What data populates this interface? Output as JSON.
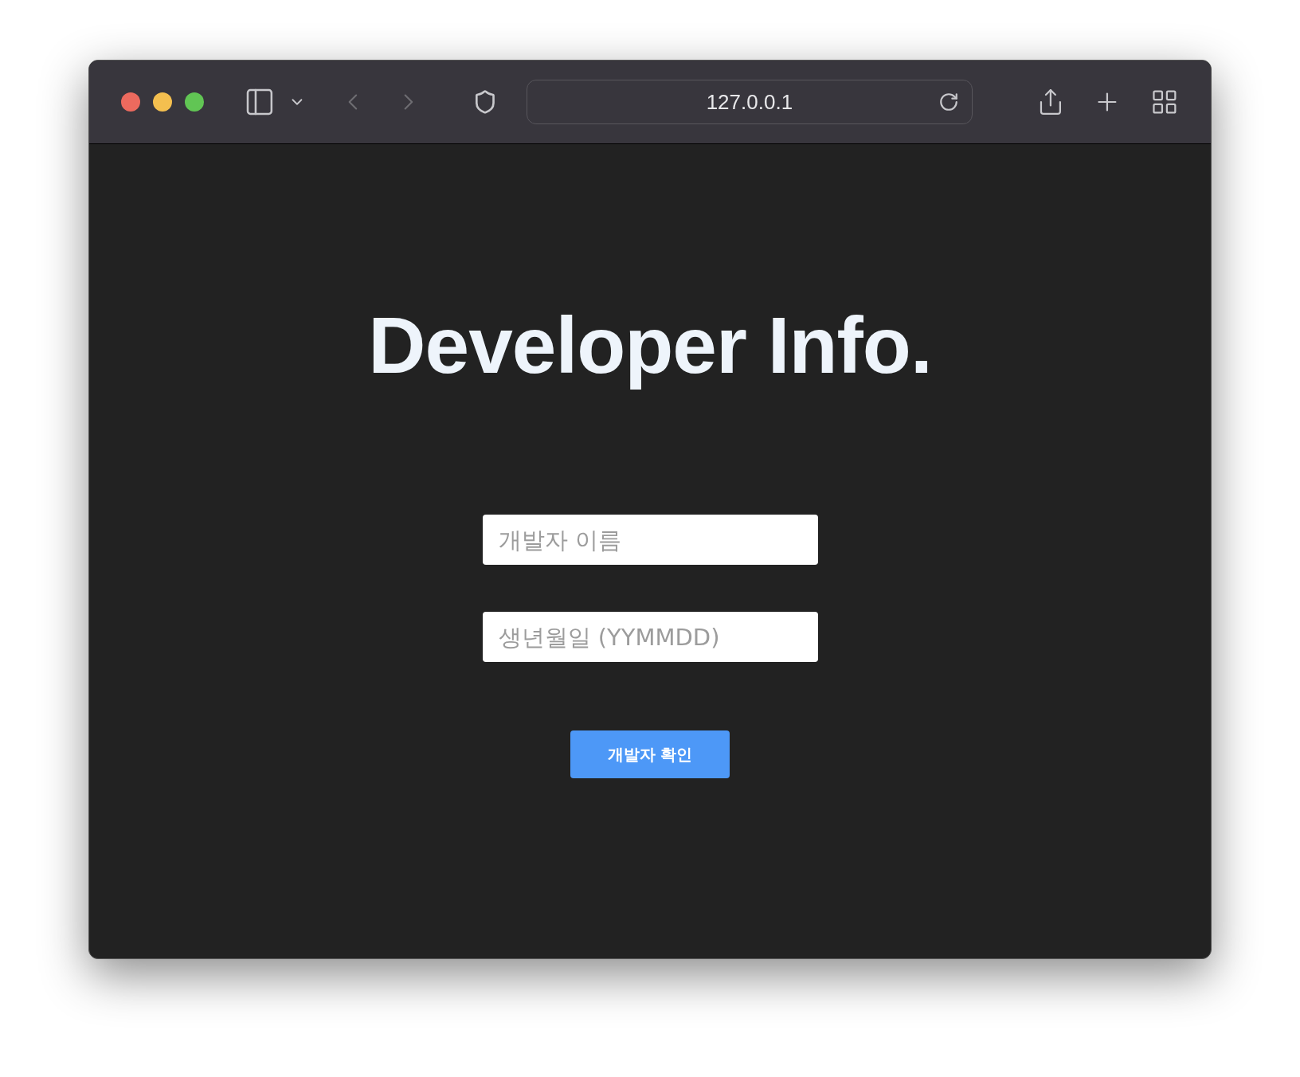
{
  "browser": {
    "url": "127.0.0.1"
  },
  "page": {
    "title": "Developer Info.",
    "fields": [
      {
        "placeholder": "개발자 이름"
      },
      {
        "placeholder": "생년월일 (YYMMDD)"
      }
    ],
    "button": "개발자 확인"
  }
}
